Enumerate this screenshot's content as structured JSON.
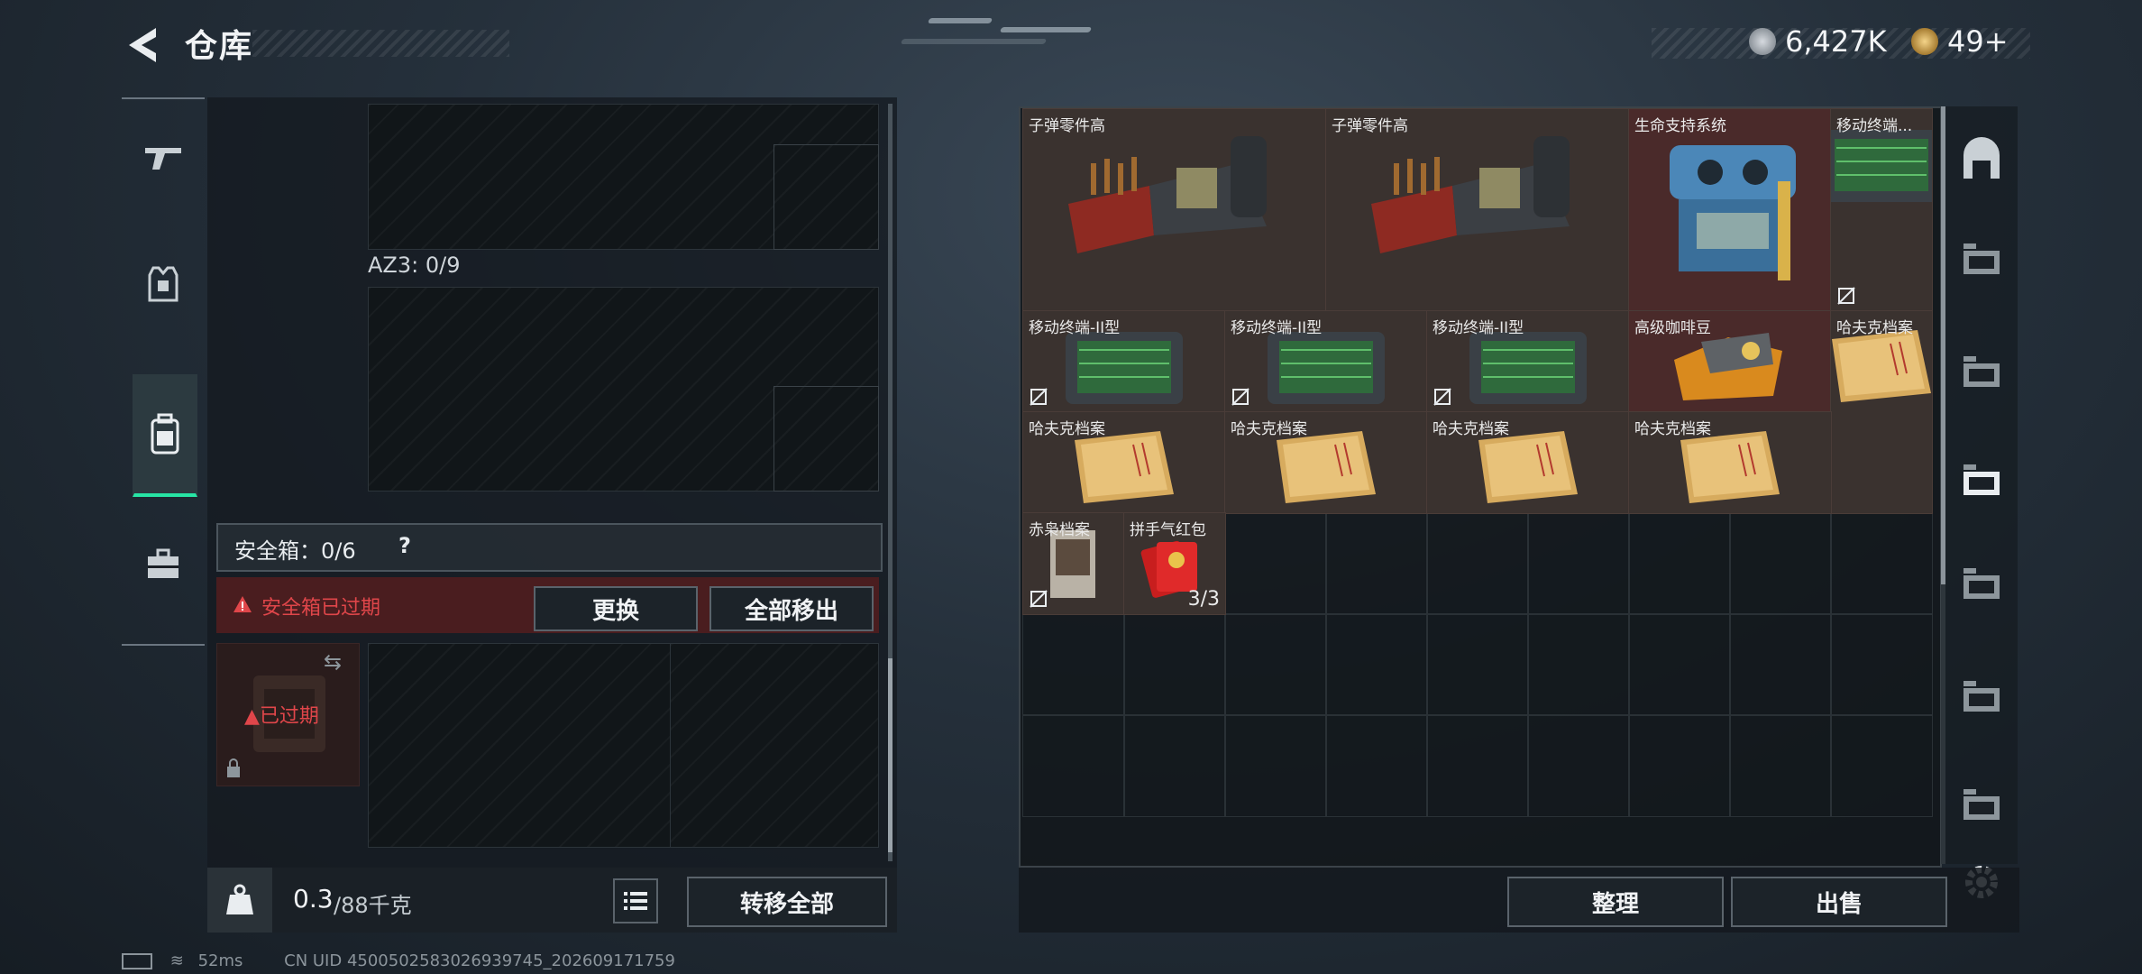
{
  "header": {
    "title": "仓库"
  },
  "currency": {
    "primary_value": "6,427K",
    "secondary_value": "49+"
  },
  "left_tabs": [
    {
      "name": "weapons",
      "icon": "gun-icon"
    },
    {
      "name": "gear",
      "icon": "armor-icon"
    },
    {
      "name": "backpack",
      "icon": "backpack-icon",
      "active": true
    },
    {
      "name": "toolbox",
      "icon": "briefcase-icon"
    }
  ],
  "loadout": {
    "az3_label": "AZ3: 0/9",
    "safe_box_label": "安全箱：0/6",
    "safe_box_help": "?",
    "warning_text": "安全箱已过期",
    "replace_button": "更换",
    "remove_all_button": "全部移出",
    "expired_label": "已过期"
  },
  "weight": {
    "current": "0.3",
    "max": "/88千克"
  },
  "transfer_all_button": "转移全部",
  "organize_button": "整理",
  "sell_button": "出售",
  "items": [
    {
      "name": "子弹零件高",
      "kind": "ammo"
    },
    {
      "name": "子弹零件高",
      "kind": "ammo"
    },
    {
      "name": "生命支持系统",
      "kind": "lifesupport"
    },
    {
      "name": "移动终端...",
      "kind": "terminal"
    },
    {
      "name": "移动终端-II型",
      "kind": "terminal"
    },
    {
      "name": "移动终端-II型",
      "kind": "terminal"
    },
    {
      "name": "移动终端-II型",
      "kind": "terminal"
    },
    {
      "name": "高级咖啡豆",
      "kind": "coffee"
    },
    {
      "name": "哈夫克档案",
      "kind": "file"
    },
    {
      "name": "哈夫克档案",
      "kind": "file"
    },
    {
      "name": "哈夫克档案",
      "kind": "file"
    },
    {
      "name": "哈夫克档案",
      "kind": "file"
    },
    {
      "name": "哈夫克档案",
      "kind": "file"
    },
    {
      "name": "赤枭档案",
      "kind": "dossier"
    },
    {
      "name": "拼手气红包",
      "kind": "redpacket",
      "count": "3/3"
    }
  ],
  "right_tabs": [
    "building-icon",
    "storage-iv-icon",
    "storage-iv-icon-2",
    "storage-active-icon",
    "storage-gti-icon",
    "storage-add-icon",
    "storage-iv-icon-3",
    "settings-icon"
  ],
  "status": {
    "ping": "52ms",
    "uid": "CN UID 45005025830269397​45_202609171759"
  },
  "colors": {
    "accent": "#27e5a5",
    "warning": "#e0464a",
    "rare_item_bg": "#4a2a2a"
  }
}
